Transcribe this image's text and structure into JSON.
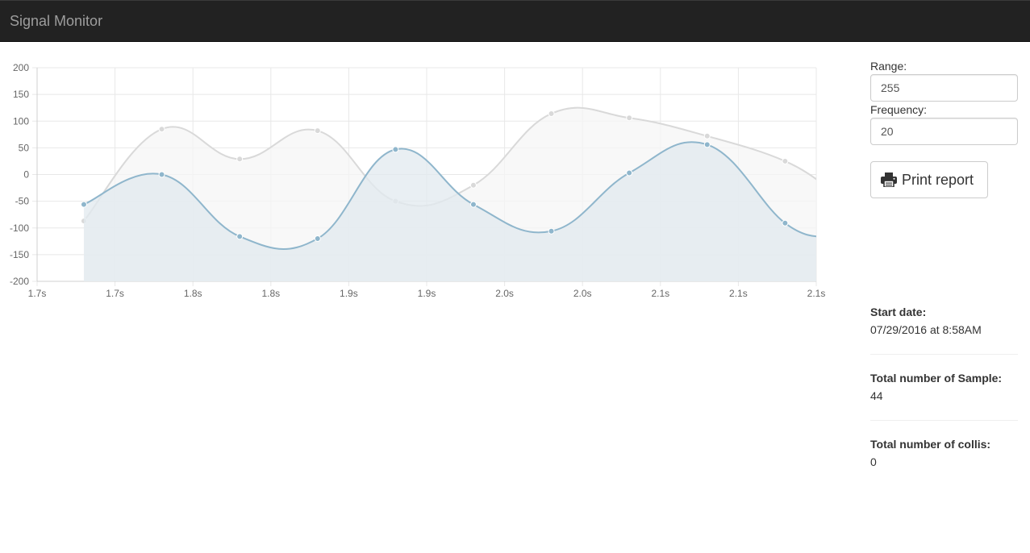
{
  "app": {
    "title": "Signal Monitor"
  },
  "controls": {
    "range_label": "Range:",
    "range_value": "255",
    "frequency_label": "Frequency:",
    "frequency_value": "20",
    "print_label": "Print report",
    "print_icon": "printer-icon"
  },
  "stats": [
    {
      "label": "Start date:",
      "value": "07/29/2016 at 8:58AM"
    },
    {
      "label": "Total number of Sample:",
      "value": "44"
    },
    {
      "label": "Total number of collis:",
      "value": "0"
    }
  ],
  "colors": {
    "series_blue": "#8fb6cc",
    "series_blue_fill": "#e2eaef",
    "series_gray": "#d9d9d9",
    "series_gray_fill": "#f5f5f5",
    "grid": "#e8e8e8"
  },
  "chart_data": {
    "type": "line",
    "x_tick_labels": [
      "1.7s",
      "1.7s",
      "1.8s",
      "1.8s",
      "1.9s",
      "1.9s",
      "2.0s",
      "2.0s",
      "2.1s",
      "2.1s",
      "2.1s"
    ],
    "y_ticks": [
      200,
      150,
      100,
      50,
      0,
      -50,
      -100,
      -150,
      -200
    ],
    "ylim": [
      -200,
      200
    ],
    "xlim": [
      0,
      10
    ],
    "grid": true,
    "series": [
      {
        "color": "#d9d9d9",
        "fill": "#f5f5f5",
        "x": [
          0.6,
          1.6,
          2.6,
          3.6,
          4.6,
          5.6,
          6.6,
          7.6,
          8.6,
          9.6,
          10.2
        ],
        "y": [
          -87,
          85,
          29,
          82,
          -50,
          -20,
          114,
          106,
          72,
          25,
          -30
        ]
      },
      {
        "color": "#8fb6cc",
        "fill": "#e2eaef",
        "x": [
          0.6,
          1.6,
          2.6,
          3.6,
          4.6,
          5.6,
          6.6,
          7.6,
          8.6,
          9.6,
          10.2
        ],
        "y": [
          -56,
          0,
          -116,
          -120,
          47,
          -56,
          -106,
          3,
          56,
          -91,
          -118
        ]
      }
    ]
  }
}
